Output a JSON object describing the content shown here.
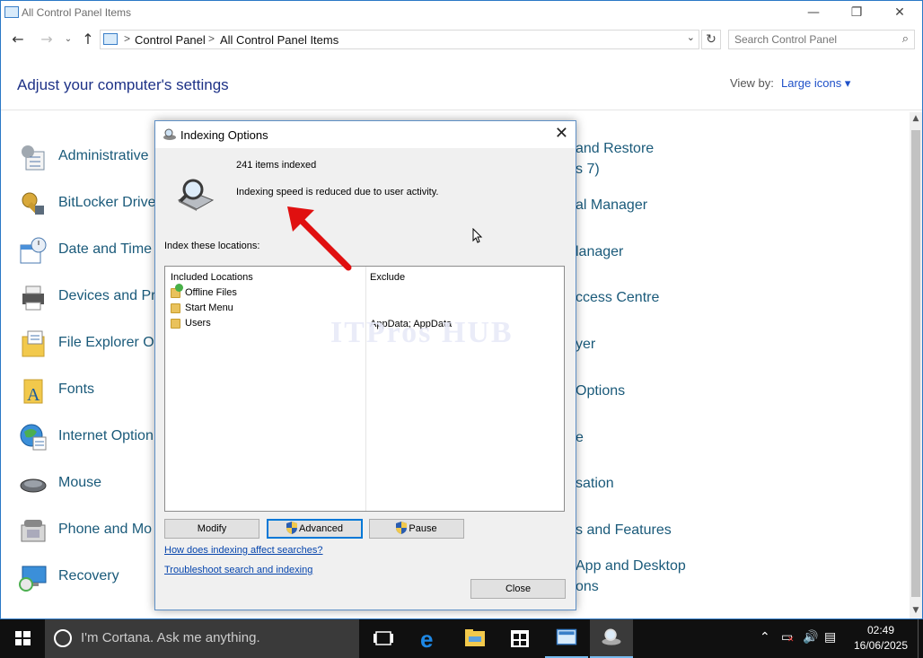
{
  "window": {
    "title": "All Control Panel Items",
    "minimize": "—",
    "maximize": "❐",
    "close": "✕"
  },
  "nav": {
    "back": "←",
    "forward": "→",
    "up": "↑",
    "breadcrumb": [
      "Control Panel",
      "All Control Panel Items"
    ],
    "separator": ">",
    "dropdown": "⌄",
    "refresh": "↻",
    "search_placeholder": "Search Control Panel"
  },
  "header": {
    "heading": "Adjust your computer's settings",
    "view_by_label": "View by:",
    "view_by_value": "Large icons ▾"
  },
  "items_left": [
    "Administrative",
    "BitLocker Drive",
    "Date and Time",
    "Devices and Pri",
    "File Explorer Op",
    "Fonts",
    "Internet Option",
    "Mouse",
    "Phone and Mo",
    "Recovery"
  ],
  "items_right": [
    "and Restore",
    "s 7)",
    "al Manager",
    "lanager",
    "ccess Centre",
    "yer",
    "Options",
    "e",
    "sation",
    "s and Features",
    "App and Desktop",
    "ons"
  ],
  "dialog": {
    "title": "Indexing Options",
    "close": "✕",
    "items_indexed": "241 items indexed",
    "status": "Indexing speed is reduced due to user activity.",
    "index_label": "Index these locations:",
    "col_included": "Included Locations",
    "col_exclude": "Exclude",
    "locations": [
      "Offline Files",
      "Start Menu",
      "Users"
    ],
    "users_exclude": "AppData; AppData",
    "buttons": {
      "modify": "Modify",
      "advanced": "Advanced",
      "pause": "Pause",
      "close": "Close"
    },
    "links": {
      "how": "How does indexing affect searches?",
      "troubleshoot": "Troubleshoot search and indexing"
    }
  },
  "watermark": "ITPros HUB",
  "taskbar": {
    "cortana": "I'm Cortana. Ask me anything.",
    "time": "02:49",
    "date": "16/06/2025"
  },
  "colors": {
    "accent": "#0078d7",
    "taskbar": "#101010",
    "link": "#0645ad",
    "arrow": "#e01010"
  }
}
